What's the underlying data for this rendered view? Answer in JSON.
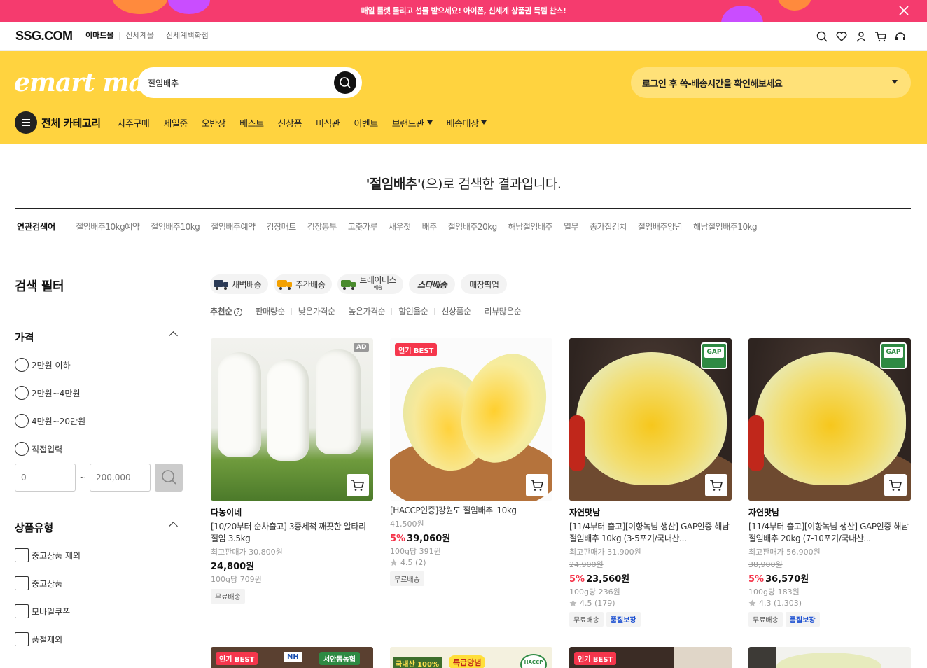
{
  "banner": {
    "text": "매일 룰렛 돌리고 선물 받으세요! 아이폰, 신세계 상품권 득템 찬스!"
  },
  "gnb": {
    "logo": "SSG.COM",
    "malls": [
      "이마트몰",
      "신세계몰",
      "신세계백화점"
    ]
  },
  "header": {
    "logo": "emart mall",
    "search_value": "절임배추",
    "delivery": "로그인 후 쓱-배송시간을 확인해보세요",
    "all_category": "전체 카테고리",
    "menu": [
      "자주구매",
      "세일중",
      "오반장",
      "베스트",
      "신상품",
      "미식관",
      "이벤트",
      "브랜드관",
      "배송매장"
    ]
  },
  "result": {
    "keyword": "'절임배추'",
    "suffix": "(으)로 검색한 결과입니다."
  },
  "related": {
    "label": "연관검색어",
    "keywords": [
      "절임배추10kg예약",
      "절임배추10kg",
      "절임배추예약",
      "김장매트",
      "김장봉투",
      "고춧가루",
      "새우젓",
      "배추",
      "절임배추20kg",
      "해남절임배추",
      "열무",
      "종가집김치",
      "절임배추양념",
      "해남절임배추10kg"
    ]
  },
  "filter": {
    "title": "검색 필터",
    "price_title": "가격",
    "price_options": [
      "2만원 이하",
      "2만원~4만원",
      "4만원~20만원",
      "직접입력"
    ],
    "price_min_placeholder": "0",
    "price_max_placeholder": "200,000",
    "tilde": "~",
    "type_title": "상품유형",
    "type_options": [
      "중고상품 제외",
      "중고상품",
      "모바일쿠폰",
      "품절제외"
    ]
  },
  "badges": [
    "새벽배송",
    "주간배송",
    "트레이더스",
    "스타배송",
    "매장픽업"
  ],
  "trader_sub": "배송",
  "sorts": [
    "추천순",
    "판매량순",
    "낮은가격순",
    "높은가격순",
    "할인율순",
    "신상품순",
    "리뷰많은순"
  ],
  "products": [
    {
      "brand": "다농이네",
      "name": "[10/20부터 순차출고] 3중세척 깨끗한 알타리 절임 3.5kg",
      "max_price": "최고판매가 30,800원",
      "price": "24,800원",
      "unit": "100g당 709원",
      "chips": [
        "무료배송"
      ],
      "tag": "AD"
    },
    {
      "brand": "",
      "name": "[HACCP인증]강원도 절임배추_10kg",
      "orig": "41,500원",
      "pct": "5%",
      "price": "39,060원",
      "unit": "100g당 391원",
      "rating": "4.5 (2)",
      "chips": [
        "무료배송"
      ],
      "tag": "인기 BEST"
    },
    {
      "brand": "자연맛남",
      "name": "[11/4부터 출고][이향녹님 생산] GAP인증 해남 절임배추 10kg (3-5포기/국내산...",
      "max_price": "최고판매가 31,900원",
      "orig": "24,900원",
      "pct": "5%",
      "price": "23,560원",
      "unit": "100g당 236원",
      "rating": "4.5 (179)",
      "chips": [
        "무료배송",
        "품질보장"
      ],
      "tag": "GAP"
    },
    {
      "brand": "자연맛남",
      "name": "[11/4부터 출고][이향녹님 생산] GAP인증 해남 절임배추 20kg (7-10포기/국내산...",
      "max_price": "최고판매가 56,900원",
      "orig": "38,900원",
      "pct": "5%",
      "price": "36,570원",
      "unit": "100g당 183원",
      "rating": "4.3 (1,303)",
      "chips": [
        "무료배송",
        "품질보장"
      ],
      "tag": "GAP"
    }
  ],
  "row2_tags": [
    "인기 BEST",
    "",
    "인기 BEST",
    ""
  ],
  "row2_texts": [
    "NH",
    "서안동농협",
    "국내산 100%",
    "특급양념",
    "HACCP"
  ],
  "colors": {
    "banner": "#f53b6e",
    "header": "#ffd33f",
    "accent_red": "#f5364c"
  }
}
